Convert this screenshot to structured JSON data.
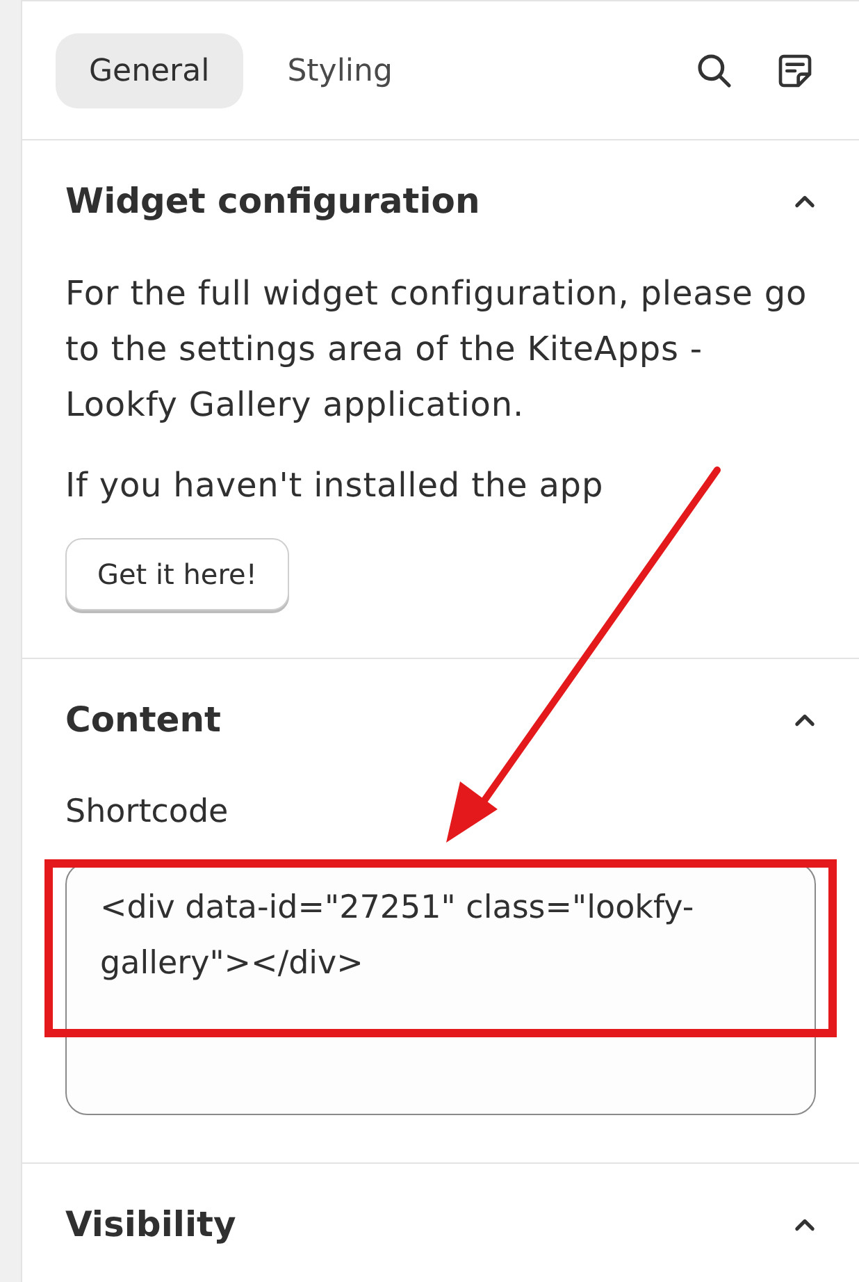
{
  "tabs": [
    {
      "label": "General",
      "selected": true
    },
    {
      "label": "Styling",
      "selected": false
    }
  ],
  "sections": [
    {
      "title": "Widget configuration",
      "expanded": true,
      "kind": "info",
      "paragraphs": [
        "For the full widget configuration, please go to the settings area of the KiteApps - Lookfy Gallery application.",
        "If you haven't installed the app"
      ],
      "button": "Get it here!"
    },
    {
      "title": "Content",
      "expanded": true,
      "kind": "field",
      "label": "Shortcode",
      "value": "<div data-id=\"27251\" class=\"lookfy-gallery\"></div>"
    },
    {
      "title": "Visibility",
      "expanded": true,
      "kind": "empty"
    }
  ]
}
